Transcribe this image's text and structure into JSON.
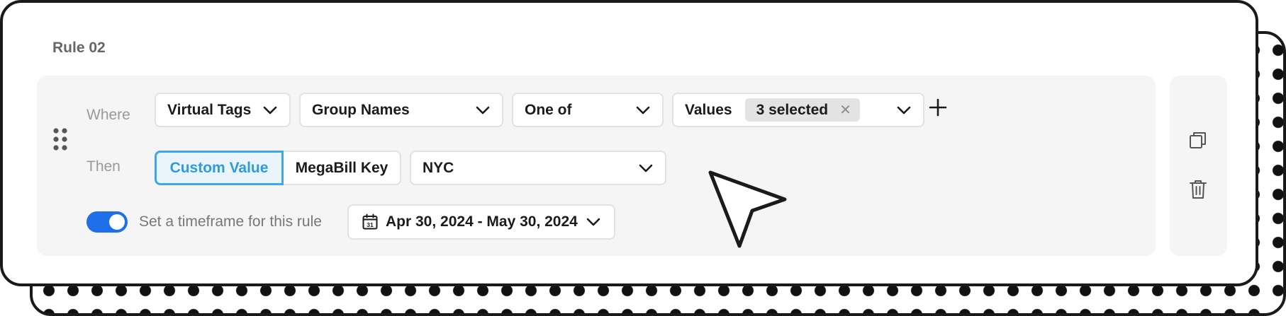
{
  "rule": {
    "title": "Rule 02",
    "where_label": "Where",
    "then_label": "Then",
    "where": {
      "tag_type": "Virtual Tags",
      "field": "Group Names",
      "operator": "One of",
      "values_label": "Values",
      "values_chip": "3 selected"
    },
    "then": {
      "modes": [
        "Custom Value",
        "MegaBill Key"
      ],
      "active_mode": "Custom Value",
      "value": "NYC"
    },
    "timeframe": {
      "enabled": true,
      "label": "Set a timeframe for this rule",
      "range": "Apr 30, 2024 - May 30, 2024",
      "calendar_day": "31"
    }
  },
  "colors": {
    "accent": "#42a5e5",
    "toggle_on": "#1f6fe8",
    "panel_bg": "#f5f5f5"
  },
  "icons": {
    "drag": "drag-handle-icon",
    "chevron": "chevron-down-icon",
    "add": "plus-icon",
    "remove_chip": "close-icon",
    "calendar": "calendar-icon",
    "duplicate": "copy-icon",
    "delete": "trash-icon",
    "pointer": "mouse-cursor-icon"
  }
}
